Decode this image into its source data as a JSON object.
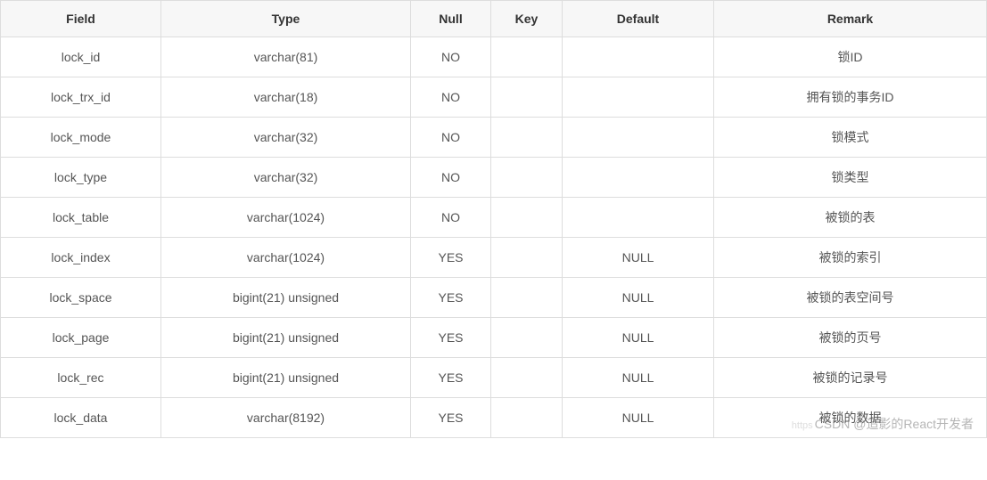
{
  "table": {
    "headers": {
      "field": "Field",
      "type": "Type",
      "null": "Null",
      "key": "Key",
      "default": "Default",
      "remark": "Remark"
    },
    "rows": [
      {
        "field": "lock_id",
        "type": "varchar(81)",
        "null": "NO",
        "key": "",
        "default": "",
        "remark": "锁ID"
      },
      {
        "field": "lock_trx_id",
        "type": "varchar(18)",
        "null": "NO",
        "key": "",
        "default": "",
        "remark": "拥有锁的事务ID"
      },
      {
        "field": "lock_mode",
        "type": "varchar(32)",
        "null": "NO",
        "key": "",
        "default": "",
        "remark": "锁模式"
      },
      {
        "field": "lock_type",
        "type": "varchar(32)",
        "null": "NO",
        "key": "",
        "default": "",
        "remark": "锁类型"
      },
      {
        "field": "lock_table",
        "type": "varchar(1024)",
        "null": "NO",
        "key": "",
        "default": "",
        "remark": "被锁的表"
      },
      {
        "field": "lock_index",
        "type": "varchar(1024)",
        "null": "YES",
        "key": "",
        "default": "NULL",
        "remark": "被锁的索引"
      },
      {
        "field": "lock_space",
        "type": "bigint(21) unsigned",
        "null": "YES",
        "key": "",
        "default": "NULL",
        "remark": "被锁的表空间号"
      },
      {
        "field": "lock_page",
        "type": "bigint(21) unsigned",
        "null": "YES",
        "key": "",
        "default": "NULL",
        "remark": "被锁的页号"
      },
      {
        "field": "lock_rec",
        "type": "bigint(21) unsigned",
        "null": "YES",
        "key": "",
        "default": "NULL",
        "remark": "被锁的记录号"
      },
      {
        "field": "lock_data",
        "type": "varchar(8192)",
        "null": "YES",
        "key": "",
        "default": "NULL",
        "remark": "被锁的数据"
      }
    ]
  },
  "watermark": {
    "prefix": "https",
    "text": "CSDN @追影的React开发者"
  }
}
